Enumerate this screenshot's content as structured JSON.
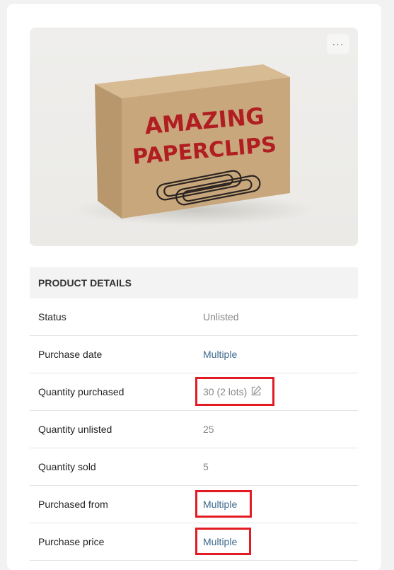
{
  "menu": {
    "more_label": "···"
  },
  "image": {
    "box_line1": "AMAZING",
    "box_line2": "PAPERCLIPS"
  },
  "details": {
    "header": "PRODUCT DETAILS",
    "rows": [
      {
        "label": "Status",
        "value": "Unlisted"
      },
      {
        "label": "Purchase date",
        "value": "Multiple"
      },
      {
        "label": "Quantity purchased",
        "value": "30 (2 lots)"
      },
      {
        "label": "Quantity unlisted",
        "value": "25"
      },
      {
        "label": "Quantity sold",
        "value": "5"
      },
      {
        "label": "Purchased from",
        "value": "Multiple"
      },
      {
        "label": "Purchase price",
        "value": "Multiple"
      }
    ]
  },
  "colors": {
    "link": "#3d6a8e",
    "highlight": "#e31b23",
    "box_text": "#b01e22",
    "box": "#c9a77c"
  },
  "icons": {
    "edit": "edit-icon",
    "more": "more-icon"
  }
}
